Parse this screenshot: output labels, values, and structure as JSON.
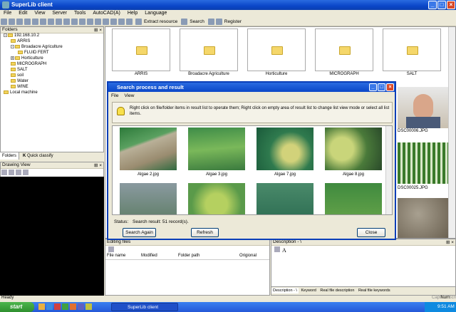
{
  "window": {
    "title": "SuperLib client"
  },
  "menu": [
    "File",
    "Edit",
    "View",
    "Server",
    "Tools",
    "AutoCAD(A)",
    "Help",
    "Language"
  ],
  "toolbar": {
    "extract": "Extract resource",
    "search": "Search",
    "register": "Register"
  },
  "folders": {
    "title": "Folders",
    "tree": [
      {
        "label": "192.168.10.2",
        "level": 0,
        "exp": "-"
      },
      {
        "label": "ARRIS",
        "level": 1,
        "exp": ""
      },
      {
        "label": "Broadacre Agriculture",
        "level": 1,
        "exp": "-"
      },
      {
        "label": "FLUID FERT",
        "level": 2,
        "exp": ""
      },
      {
        "label": "Horticulture",
        "level": 1,
        "exp": "+"
      },
      {
        "label": "MICROGRAPH",
        "level": 1,
        "exp": ""
      },
      {
        "label": "SALT",
        "level": 1,
        "exp": ""
      },
      {
        "label": "soil",
        "level": 1,
        "exp": ""
      },
      {
        "label": "Water",
        "level": 1,
        "exp": ""
      },
      {
        "label": "WINE",
        "level": 1,
        "exp": ""
      },
      {
        "label": "Local machine",
        "level": 0,
        "exp": ""
      }
    ],
    "tab_folders": "Folders",
    "tab_quick": "Quick classify"
  },
  "drawing": {
    "title": "Drawing View"
  },
  "main_folders": [
    "ARRIS",
    "Broadacre Agriculture",
    "Horticulture",
    "MICROGRAPH",
    "SALT"
  ],
  "right_files": [
    "DSC00006.JPG",
    "DSC00025.JPG"
  ],
  "dialog": {
    "title": "Search process and result",
    "menu": [
      "File",
      "View"
    ],
    "hint": "Right click on file/folder items in result list to operate them; Right click on empty area of result list to change list view mode or select all list items.",
    "results": [
      "Algae 2.jpg",
      "Algae 3.jpg",
      "Algae 7.jpg",
      "Algae 8.jpg"
    ],
    "status_label": "Status:",
    "status_value": "Search result:  51 record(s).",
    "btn_search_again": "Search Again",
    "btn_refresh": "Refresh",
    "btn_close": "Close"
  },
  "editing": {
    "title": "Editing files",
    "cols": [
      "File name",
      "Modified",
      "Folder path",
      "Origional"
    ]
  },
  "description": {
    "title": "Description - \\",
    "tabs": [
      "Description - \\",
      "Keyword",
      "Real file description",
      "Real file keywords"
    ]
  },
  "status": {
    "text": "Ready",
    "indicators": [
      "Caps",
      "Num",
      "Scrl"
    ]
  },
  "taskbar": {
    "start": "start",
    "task": "SuperLib client",
    "time": "9:51 AM"
  }
}
